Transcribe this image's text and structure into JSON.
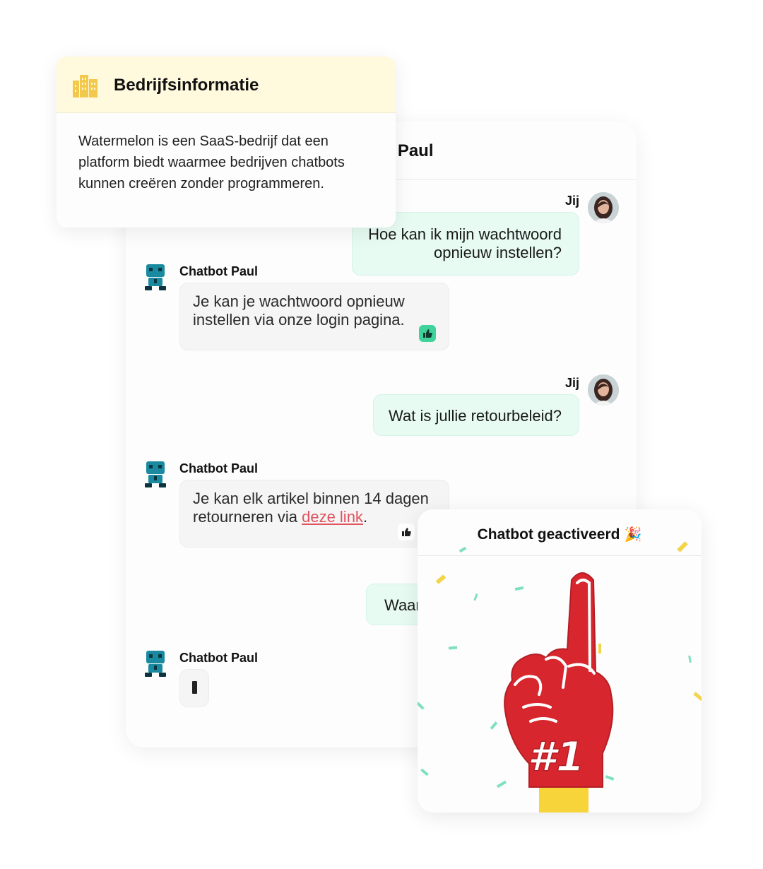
{
  "chat": {
    "title": "Chatbot Paul",
    "messages": [
      {
        "sender": "Jij",
        "text": "Hoe kan ik mijn wachtwoord opnieuw instellen?"
      },
      {
        "sender": "Chatbot Paul",
        "text": "Je kan je wachtwoord opnieuw instellen via onze login pagina."
      },
      {
        "sender": "Jij",
        "text": "Wat is jullie retourbeleid?"
      },
      {
        "sender": "Chatbot Paul",
        "text_before": "Je kan elk artikel binnen 14 dagen retourneren via ",
        "link_text": "deze link",
        "text_after": "."
      },
      {
        "sender": "",
        "text": "Waar"
      },
      {
        "sender": "Chatbot Paul",
        "text": ""
      }
    ]
  },
  "info_card": {
    "title": "Bedrijfsinformatie",
    "body": "Watermelon is een SaaS-bedrijf dat een platform biedt waarmee bedrijven chatbots kunnen creëren zonder programmeren."
  },
  "activated_card": {
    "title": "Chatbot geactiveerd",
    "title_icon": "party-popper-icon",
    "foam_finger_text": "#1"
  },
  "icons": {
    "user_avatar": "user-avatar",
    "bot_avatar": "robot-icon",
    "like": "thumbs-up-icon",
    "company": "buildings-icon"
  },
  "colors": {
    "user_bubble": "#e7fbf3",
    "bot_bubble": "#f5f5f5",
    "like_active": "#3fd39b",
    "link": "#e0535f",
    "info_header": "#fff9de",
    "foam_finger": "#d7262e",
    "bot": "#1a8aa0"
  }
}
